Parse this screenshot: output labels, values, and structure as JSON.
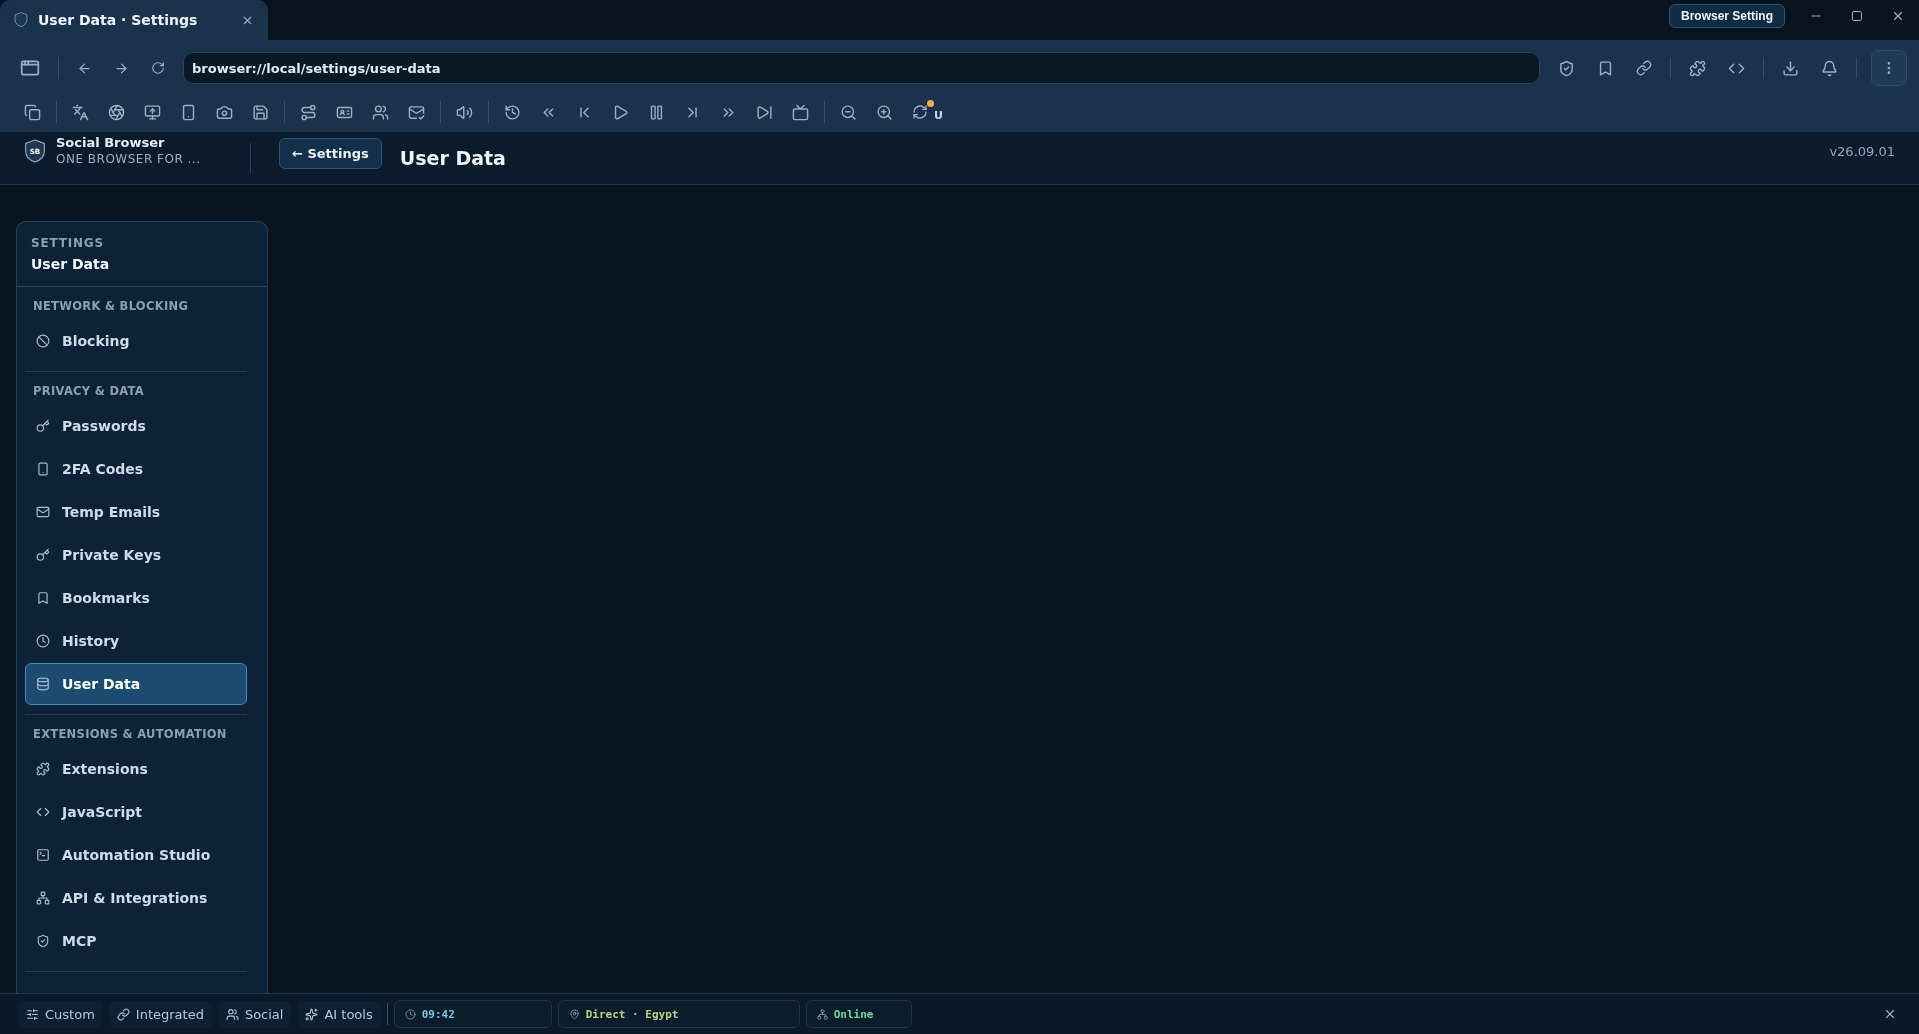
{
  "tab": {
    "title": "User Data · Settings",
    "selected": true
  },
  "window_badge": "Browser Setting",
  "address": {
    "value": "browser://local/settings/user-data"
  },
  "toolbar_badge": "U",
  "header": {
    "logo": "SB",
    "app_name": "Social Browser",
    "tagline": "ONE BROWSER FOR ...",
    "back_button": "← Settings",
    "title": "User Data",
    "version": "v26.09.01"
  },
  "sidebar": {
    "eyebrow": "SETTINGS",
    "title": "User Data",
    "sections": [
      {
        "heading": "NETWORK & BLOCKING",
        "items": [
          {
            "label": "Blocking",
            "selected": false
          }
        ]
      },
      {
        "heading": "PRIVACY & DATA",
        "items": [
          {
            "label": "Passwords",
            "selected": false
          },
          {
            "label": "2FA Codes",
            "selected": false
          },
          {
            "label": "Temp Emails",
            "selected": false
          },
          {
            "label": "Private Keys",
            "selected": false
          },
          {
            "label": "Bookmarks",
            "selected": false
          },
          {
            "label": "History",
            "selected": false
          },
          {
            "label": "User Data",
            "selected": true
          }
        ]
      },
      {
        "heading": "EXTENSIONS & AUTOMATION",
        "items": [
          {
            "label": "Extensions",
            "selected": false
          },
          {
            "label": "JavaScript",
            "selected": false
          },
          {
            "label": "Automation Studio",
            "selected": false
          },
          {
            "label": "API & Integrations",
            "selected": false
          },
          {
            "label": "MCP",
            "selected": false
          }
        ]
      }
    ]
  },
  "status_bar": {
    "modes": [
      "Custom",
      "Integrated",
      "Social",
      "AI tools"
    ],
    "chips": [
      {
        "kind": "time",
        "text": "09:42"
      },
      {
        "kind": "route",
        "text": "Direct · Egypt"
      },
      {
        "kind": "network",
        "text": "Online"
      }
    ]
  }
}
